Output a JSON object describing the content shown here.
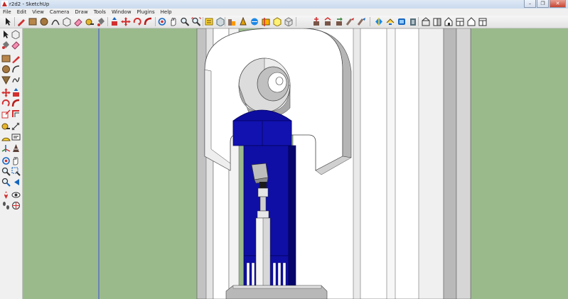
{
  "window": {
    "title": "r2d2 - SketchUp",
    "minimize_glyph": "–",
    "maximize_glyph": "❐",
    "close_glyph": "✕"
  },
  "menu": {
    "items": [
      "File",
      "Edit",
      "View",
      "Camera",
      "Draw",
      "Tools",
      "Window",
      "Plugins",
      "Help"
    ]
  },
  "toolbar": {
    "icons": [
      "select-icon",
      "pencil-line-icon",
      "rectangle-icon",
      "circle-icon",
      "arc-icon",
      "make-component-icon",
      "eraser-icon",
      "tape-measure-icon",
      "paint-bucket-icon",
      "push-pull-icon",
      "move-icon",
      "rotate-icon",
      "follow-me-icon",
      "orbit-icon",
      "pan-icon",
      "zoom-icon",
      "zoom-extents-icon",
      "previous-view-icon",
      "next-view-icon",
      "get-models-icon",
      "share-model-icon",
      "3d-text-icon",
      "styles-icon",
      "xray-icon",
      "section-plane-icon",
      "component-icon",
      "iso-view-icon",
      "top-view-icon",
      "front-view-icon",
      "right-view-icon",
      "back-view-icon",
      "left-view-icon",
      "shadows-icon",
      "fog-icon",
      "layers-icon",
      "house-icon",
      "wireframe-icon",
      "hidden-line-icon",
      "shaded-icon",
      "textured-icon",
      "monochrome-icon"
    ]
  },
  "colors": {
    "viewport_background": "#9aba8c",
    "droid_blue": "#1010a8",
    "droid_white": "#ffffff",
    "droid_grey": "#c8c8c8",
    "axis_blue": "#3b4fd8"
  }
}
